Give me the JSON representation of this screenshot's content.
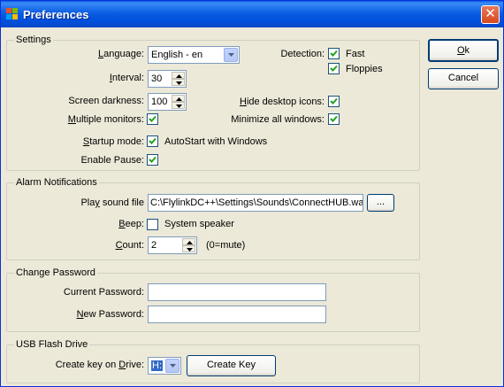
{
  "window": {
    "title": "Preferences"
  },
  "settings": {
    "legend": "Settings",
    "language": {
      "label": "Language:",
      "value": "English - en"
    },
    "interval": {
      "label": "Interval:",
      "value": "30"
    },
    "screen_darkness": {
      "label": "Screen darkness:",
      "value": "100"
    },
    "multiple_monitors": {
      "label": "Multiple monitors:",
      "checked": true
    },
    "startup_mode": {
      "label": "Startup mode:",
      "option": "AutoStart with Windows",
      "checked": true
    },
    "enable_pause": {
      "label": "Enable Pause:",
      "checked": true
    },
    "detection": {
      "label": "Detection:",
      "fast": "Fast",
      "floppies": "Floppies",
      "fast_checked": true,
      "floppies_checked": true
    },
    "hide_desktop_icons": {
      "label": "Hide desktop icons:",
      "checked": true
    },
    "minimize_all_windows": {
      "label": "Minimize all windows:",
      "checked": true
    }
  },
  "alarm": {
    "legend": "Alarm Notifications",
    "play_sound": {
      "label": "Play sound file",
      "value": "C:\\FlylinkDC++\\Settings\\Sounds\\ConnectHUB.wa",
      "browse": "..."
    },
    "beep": {
      "label": "Beep:",
      "option": "System speaker",
      "checked": false
    },
    "count": {
      "label": "Count:",
      "value": "2",
      "hint": "(0=mute)"
    }
  },
  "password": {
    "legend": "Change Password",
    "current": {
      "label": "Current Password:",
      "value": ""
    },
    "new": {
      "label": "New Password:",
      "value": ""
    }
  },
  "usb": {
    "legend": "USB Flash Drive",
    "drive": {
      "label": "Create key on Drive:",
      "value": "H:"
    },
    "create_key": "Create Key"
  },
  "buttons": {
    "ok": "Ok",
    "cancel": "Cancel"
  },
  "colors": {
    "titlebar": "#0054e3",
    "dialog_bg": "#ece9d8",
    "check_mark": "#21a121"
  }
}
